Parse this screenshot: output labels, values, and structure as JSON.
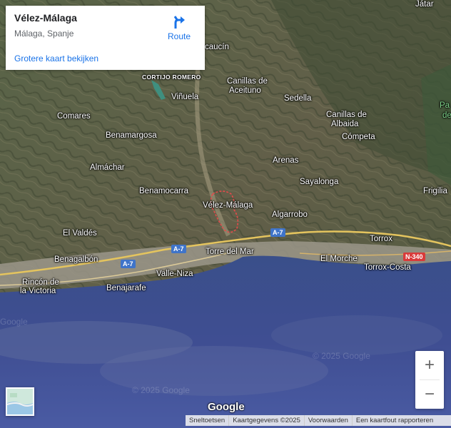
{
  "info_card": {
    "title": "Vélez-Málaga",
    "subtitle": "Málaga, Spanje",
    "route_label": "Route",
    "larger_map_link": "Grotere kaart bekijken"
  },
  "places": [
    {
      "name": "Játar"
    },
    {
      "name": "Canillas de"
    },
    {
      "name": "Aceituno"
    },
    {
      "name": "Viñuela"
    },
    {
      "name": "Sedella"
    },
    {
      "name": "Comares"
    },
    {
      "name": "Canillas de"
    },
    {
      "name": "Albaida"
    },
    {
      "name": "Benamargosa"
    },
    {
      "name": "Cómpeta"
    },
    {
      "name": "Almáchar"
    },
    {
      "name": "Arenas"
    },
    {
      "name": "Sayalonga"
    },
    {
      "name": "Benamocarra"
    },
    {
      "name": "Vélez-Málaga"
    },
    {
      "name": "Algarrobo"
    },
    {
      "name": "Frigilia"
    },
    {
      "name": "El Valdés"
    },
    {
      "name": "Torrox"
    },
    {
      "name": "Benagalbón"
    },
    {
      "name": "Torre del Mar"
    },
    {
      "name": "El Morche"
    },
    {
      "name": "Torrox-Costa"
    },
    {
      "name": "Valle-Niza"
    },
    {
      "name": "Rincón de"
    },
    {
      "name": "la Victoria"
    },
    {
      "name": "Benajarafe"
    },
    {
      "name": "caucín"
    },
    {
      "name": "CORTIJO ROMERO"
    },
    {
      "name": "Pa"
    },
    {
      "name": "de"
    }
  ],
  "road_shields": [
    {
      "label": "A-7"
    },
    {
      "label": "A-7"
    },
    {
      "label": "A-7"
    },
    {
      "label": "N-340"
    }
  ],
  "zoom": {
    "in": "+",
    "out": "−"
  },
  "branding": "Google",
  "watermarks": [
    "© 2025 Google",
    "© 2025 Google",
    "Google"
  ],
  "footer": {
    "shortcuts": "Sneltoetsen",
    "map_data": "Kaartgegevens ©2025",
    "terms": "Voorwaarden",
    "report": "Een kaartfout rapporteren"
  },
  "colors": {
    "link": "#1a73e8",
    "motorway_shield": "#3f74c9",
    "national_road_shield": "#d93a3a",
    "sea": "#3a4e8e",
    "marker_outline": "#e24b4b"
  },
  "icons": {
    "route": "route-arrow-icon",
    "layer_toggle": "satellite-thumbnail"
  }
}
